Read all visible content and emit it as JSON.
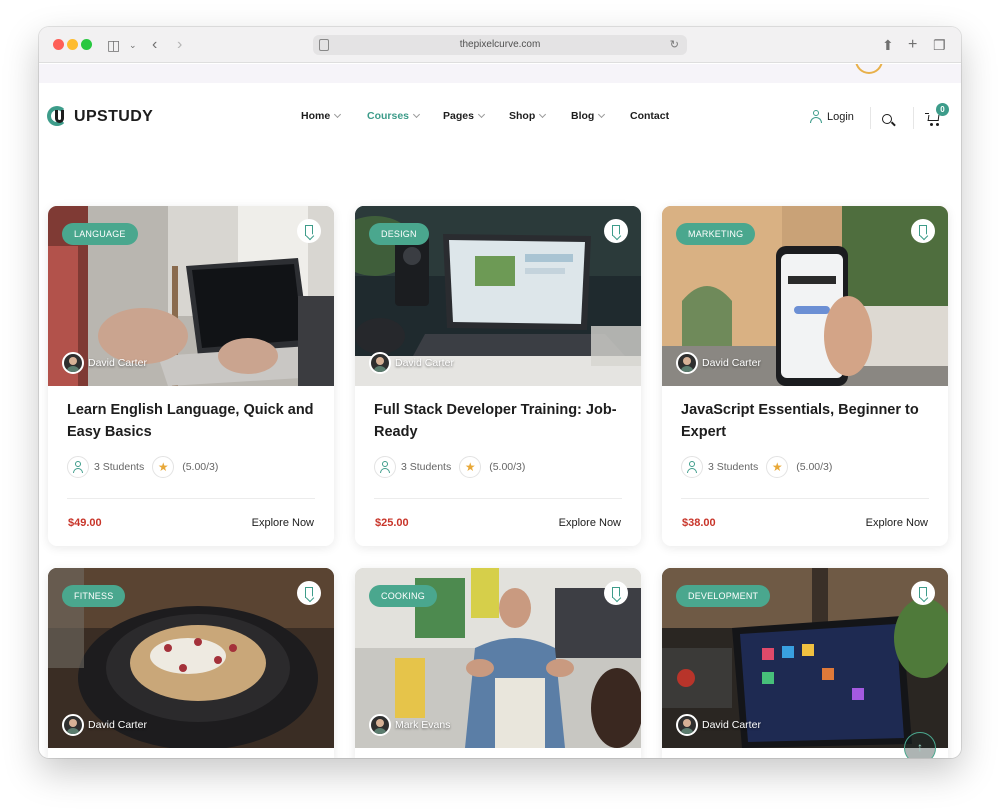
{
  "browser": {
    "url": "thepixelcurve.com"
  },
  "header": {
    "logo_text": "UPSTUDY",
    "nav": [
      {
        "label": "Home",
        "dropdown": true
      },
      {
        "label": "Courses",
        "dropdown": true,
        "active": true
      },
      {
        "label": "Pages",
        "dropdown": true
      },
      {
        "label": "Shop",
        "dropdown": true
      },
      {
        "label": "Blog",
        "dropdown": true
      },
      {
        "label": "Contact",
        "dropdown": false
      }
    ],
    "login_label": "Login",
    "cart_count": "0"
  },
  "theme": {
    "accent": "#3d9c8a",
    "badge": "#4aa78e",
    "price": "#c8352a",
    "star": "#e8a838"
  },
  "courses": [
    {
      "category": "LANGUAGE",
      "author": "David Carter",
      "title": "Learn English Language, Quick and Easy Basics",
      "students": "3 Students",
      "rating": "(5.00/3)",
      "price": "$49.00",
      "cta": "Explore Now"
    },
    {
      "category": "DESIGN",
      "author": "David Carter",
      "title": "Full Stack Developer Training: Job-Ready",
      "students": "3 Students",
      "rating": "(5.00/3)",
      "price": "$25.00",
      "cta": "Explore Now"
    },
    {
      "category": "MARKETING",
      "author": "David Carter",
      "title": "JavaScript Essentials, Beginner to Expert",
      "students": "3 Students",
      "rating": "(5.00/3)",
      "price": "$38.00",
      "cta": "Explore Now"
    },
    {
      "category": "FITNESS",
      "author": "David Carter"
    },
    {
      "category": "COOKING",
      "author": "Mark Evans"
    },
    {
      "category": "DEVELOPMENT",
      "author": "David Carter"
    }
  ],
  "scroll_top_icon": "arrow-up-icon"
}
